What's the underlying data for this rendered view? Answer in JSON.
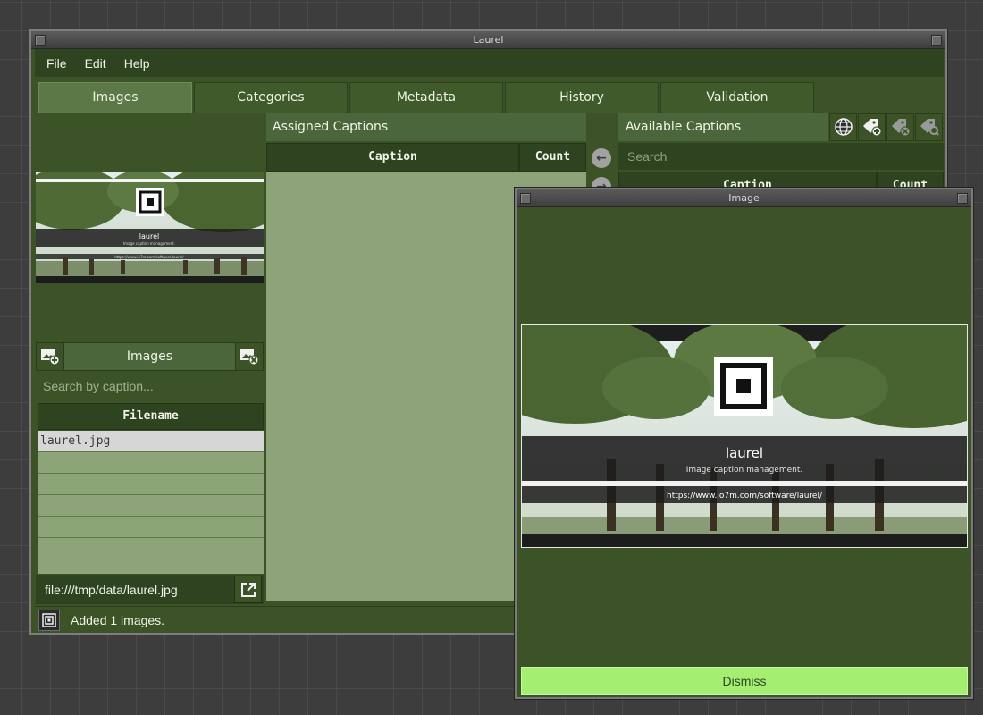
{
  "window": {
    "title": "Laurel"
  },
  "menu": [
    "File",
    "Edit",
    "Help"
  ],
  "tabs": [
    "Images",
    "Categories",
    "Metadata",
    "History",
    "Validation"
  ],
  "left": {
    "images_label": "Images",
    "search_placeholder": "Search by caption...",
    "filename_header": "Filename",
    "files": [
      "laurel.jpg",
      "",
      "",
      "",
      "",
      "",
      ""
    ],
    "selected_index": 0,
    "path": "file:///tmp/data/laurel.jpg"
  },
  "assigned": {
    "header": "Assigned Captions",
    "columns": {
      "caption": "Caption",
      "count": "Count"
    }
  },
  "available": {
    "header": "Available Captions",
    "search_placeholder": "Search",
    "columns": {
      "caption": "Caption",
      "count": "Count"
    }
  },
  "preview": {
    "title": "laurel",
    "subtitle": "Image caption management.",
    "url": "https://www.io7m.com/software/laurel/"
  },
  "status": {
    "message": "Added 1 images."
  },
  "dialog": {
    "title": "Image",
    "dismiss_label": "Dismiss"
  },
  "icons": {
    "add_image": "image-add-icon",
    "remove_image": "image-remove-icon",
    "open_external": "open-external-icon",
    "arrow_left": "arrow-left-icon",
    "arrow_right": "arrow-right-icon",
    "globe": "globe-icon",
    "tag_add": "tag-add-icon",
    "tag_remove": "tag-remove-icon",
    "tag_search": "tag-search-icon"
  },
  "colors": {
    "accent": "#a4ee72",
    "panel": "#3c5328",
    "row": "#8ca478",
    "selected_row": "#d6d6d6"
  }
}
